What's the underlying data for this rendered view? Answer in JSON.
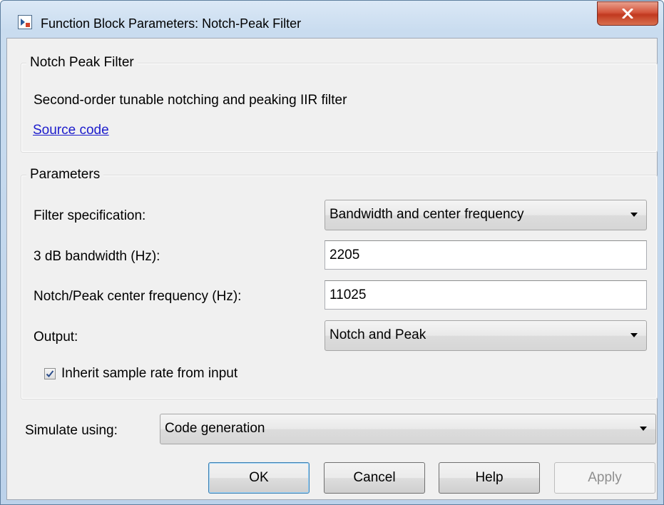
{
  "window": {
    "title": "Function Block Parameters: Notch-Peak Filter",
    "icon": "simulink-block-icon",
    "close_icon": "close-icon"
  },
  "description_group": {
    "legend": "Notch Peak Filter",
    "description": "Second-order tunable notching and peaking IIR filter",
    "source_link": "Source code"
  },
  "parameters_group": {
    "legend": "Parameters",
    "filter_specification": {
      "label": "Filter specification:",
      "value": "Bandwidth and center frequency"
    },
    "bandwidth": {
      "label": "3 dB bandwidth (Hz):",
      "value": "2205"
    },
    "center_frequency": {
      "label": "Notch/Peak center frequency (Hz):",
      "value": "11025"
    },
    "output": {
      "label": "Output:",
      "value": "Notch and Peak"
    },
    "inherit_sample_rate": {
      "label": "Inherit sample rate from input",
      "checked": true
    }
  },
  "simulate": {
    "label": "Simulate using:",
    "value": "Code generation"
  },
  "buttons": {
    "ok": "OK",
    "cancel": "Cancel",
    "help": "Help",
    "apply": "Apply"
  },
  "colors": {
    "link": "#1c1ccc",
    "close_button": "#c1391f",
    "default_button_border": "#3c7fb1",
    "disabled_text": "#8f8f8f"
  }
}
